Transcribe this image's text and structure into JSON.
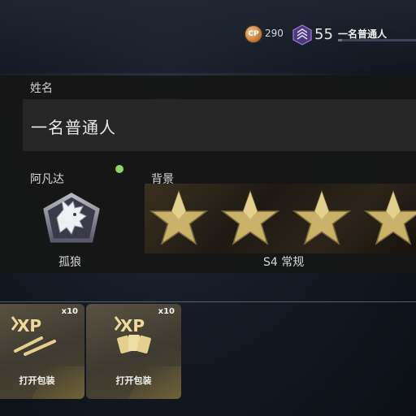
{
  "header": {
    "cp_icon_label": "CP",
    "cp_value": "290",
    "rank_value": "55",
    "player_name": "一名普通人",
    "xp_progress": 0.05,
    "colors": {
      "cp": "#c07a36",
      "rank": "#8a6cc8"
    }
  },
  "profile": {
    "name_label": "姓名",
    "name_value": "一名普通人",
    "emblem_label": "阿凡达",
    "emblem_name": "孤狼",
    "background_label": "背景",
    "calling_card_name": "S4 常规",
    "new_indicator_color": "#8fd16a"
  },
  "packs": [
    {
      "count": "x10",
      "icon": "xp-bullets-icon",
      "action": "打开包装"
    },
    {
      "count": "x10",
      "icon": "xp-cards-icon",
      "action": "打开包装"
    }
  ]
}
